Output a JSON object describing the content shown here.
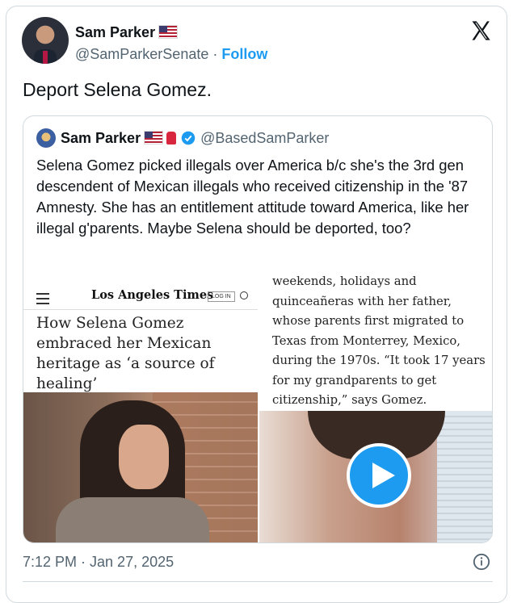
{
  "author": {
    "name": "Sam Parker",
    "flag_icon": "us-flag-icon",
    "handle": "@SamParkerSenate",
    "separator": "·",
    "follow_label": "Follow"
  },
  "tweet": {
    "text": "Deport Selena Gomez.",
    "timestamp": "7:12 PM · Jan 27, 2025"
  },
  "quoted": {
    "name": "Sam Parker",
    "handle": "@BasedSamParker",
    "icons": [
      "us-flag-icon",
      "fire-extinguisher-icon",
      "verified-badge-icon"
    ],
    "text": "Selena Gomez picked illegals over America b/c she's the 3rd gen descendent of Mexican illegals who received citizenship in the '87 Amnesty. She has an entitlement attitude toward America, like her illegal g'parents. Maybe Selena should be deported, too?"
  },
  "media_left": {
    "publication": "Los Angeles Times",
    "login_label": "LOG IN",
    "headline": "How Selena Gomez embraced her Mexican heritage as ‘a source of healing’"
  },
  "media_right": {
    "article_text": "weekends, holidays and quinceañeras with her father, whose parents first migrated to Texas from Monterrey, Mexico, during the 1970s. “It took 17 years for my grandparents to get citizenship,” says Gomez."
  },
  "colors": {
    "accent": "#1d9bf0",
    "text": "#0f1419",
    "muted": "#536471",
    "border": "#cfd9de"
  }
}
